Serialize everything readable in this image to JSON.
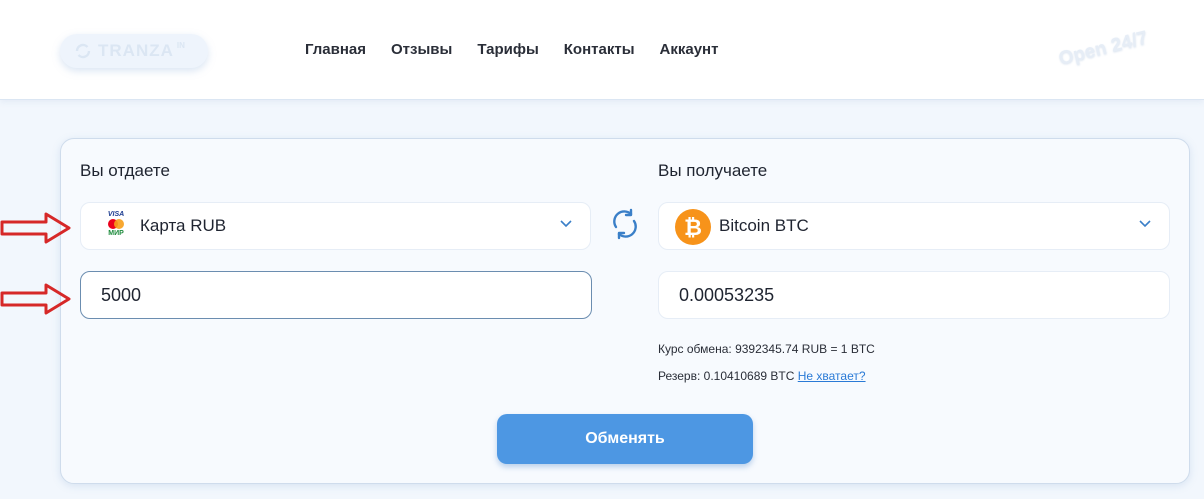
{
  "header": {
    "logo_text": "TRANZA",
    "logo_sup": "IN",
    "nav": [
      "Главная",
      "Отзывы",
      "Тарифы",
      "Контакты",
      "Аккаунт"
    ],
    "badge": "Open 24/7"
  },
  "give": {
    "label": "Вы отдаете",
    "currency": "Карта RUB",
    "icon_visa": "VISA",
    "icon_mir": "МИР",
    "amount": "5000"
  },
  "get": {
    "label": "Вы получаете",
    "currency": "Bitcoin BTC",
    "amount": "0.00053235"
  },
  "rate": {
    "label": "Курс обмена:",
    "value": "9392345.74 RUB = 1 BTC"
  },
  "reserve": {
    "label": "Резерв:",
    "value": "0.10410689 BTC",
    "link": "Не хватает?"
  },
  "submit_label": "Обменять",
  "colors": {
    "accent": "#4d97e3",
    "annotation_arrow": "#d62828",
    "btc": "#f7931a"
  }
}
